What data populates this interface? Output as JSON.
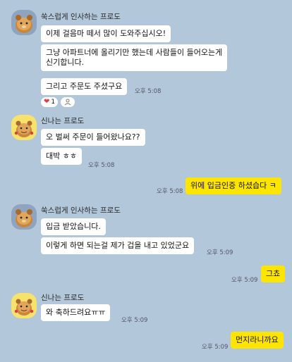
{
  "senders": {
    "a": "쑥스럽게 인사하는 프로도",
    "b": "신나는 프로도"
  },
  "messages": {
    "m1": "이제 걸음마 떼서 많이 도와주십시오!",
    "m2_l1": "그냥 아파트너에 올리기만 했는데 사람들이 들어오는게",
    "m2_l2": "신기합니다.",
    "m3": "그리고 주문도 주셨구요",
    "m4": "오 벌써 주문이 들어왔나요??",
    "m5": "대박 ㅎㅎ",
    "m6": "위에 입금인증 하셨습다 ㅋ",
    "m7": "입금 받았습니다.",
    "m8": "이렇게 하면 되는걸 제가 겁을 내고 있었군요",
    "m9": "그쵸",
    "m10": "와 축하드려요ㅠㅠ",
    "m11": "먼지라니까요"
  },
  "times": {
    "t1": "오후 5:08",
    "t2": "오후 5:08",
    "t3": "오후 5:08",
    "t4": "오후 5:09",
    "t5": "오후 5:09",
    "t6": "오후 5:09",
    "t7": "오후 5:09"
  },
  "reaction": {
    "count": "1"
  },
  "colors": {
    "background": "#b2c7da",
    "my_bubble": "#fee500",
    "heart": "#e8373e"
  }
}
